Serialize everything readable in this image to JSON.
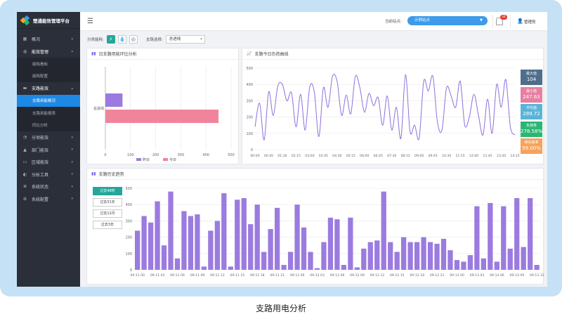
{
  "app": {
    "title": "楚通能效管理平台"
  },
  "sidebar": {
    "items": [
      {
        "label": "概况",
        "icon": "dashboard-icon",
        "sub": false
      },
      {
        "label": "能效管理",
        "icon": "energy-icon",
        "sub": false,
        "open": true
      },
      {
        "label": "能耗看板",
        "sub": true
      },
      {
        "label": "能耗配置",
        "sub": true
      },
      {
        "label": "支路能效",
        "icon": "branch-icon",
        "sub": false,
        "open": true
      },
      {
        "label": "支路用能概况",
        "sub": true,
        "active": true
      },
      {
        "label": "支路用能报表",
        "sub": true
      },
      {
        "label": "同比分析",
        "sub": true
      },
      {
        "label": "分项能效",
        "icon": "category-icon",
        "sub": false
      },
      {
        "label": "部门能效",
        "icon": "department-icon",
        "sub": false
      },
      {
        "label": "区域能效",
        "icon": "region-icon",
        "sub": false
      },
      {
        "label": "分析工具",
        "icon": "tools-icon",
        "sub": false
      },
      {
        "label": "系统状态",
        "icon": "status-icon",
        "sub": false
      },
      {
        "label": "系统配置",
        "icon": "settings-icon",
        "sub": false
      }
    ]
  },
  "topbar": {
    "site_label": "当前站点:",
    "site_value": "示例站点",
    "notification_count": "34",
    "user_name": "管理员"
  },
  "filter": {
    "energy_label": "分类能耗:",
    "branch_label": "支路选择:",
    "branch_value": "总进线"
  },
  "ring_panel": {
    "title": "日支路用能环比分析"
  },
  "load_panel": {
    "title": "支路今日负荷曲线"
  },
  "history_panel": {
    "title": "支路历史趋势"
  },
  "stats": [
    {
      "label": "最大值",
      "value": "104",
      "color": "#4f6e8c"
    },
    {
      "label": "最小值",
      "value": "247.63",
      "color": "#e97ea1"
    },
    {
      "label": "平均值",
      "value": "289.72",
      "color": "#5bb4d8"
    },
    {
      "label": "负荷率",
      "value": "278.58%",
      "color": "#2bb673"
    },
    {
      "label": "峰谷差率",
      "value": "59.00%",
      "color": "#f7a25c"
    }
  ],
  "range_buttons": [
    "过去48时",
    "过去31天",
    "过去12月",
    "过去3年"
  ],
  "caption": "支路用电分析",
  "colors": {
    "accent": "#1e88e5",
    "purple": "#9b7bdf",
    "pink": "#f0849c",
    "teal": "#26a69a"
  },
  "chart_data": [
    {
      "type": "bar",
      "orientation": "horizontal",
      "categories": [
        "总进线"
      ],
      "series": [
        {
          "name": "昨日",
          "values": [
            68
          ]
        },
        {
          "name": "今日",
          "values": [
            450
          ]
        }
      ],
      "xlim": [
        0,
        500
      ],
      "xticks": [
        "0",
        "100",
        "200",
        "300",
        "400",
        "500"
      ],
      "legend": "bottom"
    },
    {
      "type": "line",
      "x": [
        "00:00",
        "00:45",
        "01:30",
        "02:15",
        "03:00",
        "03:45",
        "04:30",
        "05:15",
        "06:00",
        "06:45",
        "07:30",
        "08:15",
        "09:00",
        "09:45",
        "10:30",
        "11:15",
        "12:00",
        "12:45",
        "13:30",
        "14:15"
      ],
      "y": [
        140,
        285,
        60,
        355,
        210,
        390,
        400,
        300,
        350,
        140,
        340,
        120,
        385,
        355,
        80,
        380,
        260,
        450,
        420,
        210,
        335,
        220,
        450,
        380,
        230,
        345,
        270,
        320,
        150,
        330,
        120,
        260,
        70,
        460,
        110,
        150,
        70,
        420,
        360,
        450,
        170,
        120,
        380,
        330,
        260,
        420,
        150,
        200,
        340,
        210,
        90,
        310,
        100,
        400,
        260,
        430,
        140,
        90
      ],
      "ylim": [
        0,
        500
      ],
      "yticks": [
        "0",
        "100",
        "200",
        "300",
        "400",
        "500"
      ],
      "grid": true
    },
    {
      "type": "bar",
      "x_tick_labels": [
        "09-11 00",
        "09-11 03",
        "09-11 06",
        "09-11 09",
        "09-11 12",
        "09-11 15",
        "09-11 18",
        "09-11 21",
        "09-12 00",
        "09-12 03",
        "09-12 06",
        "09-12 09",
        "09-12 12",
        "09-12 15",
        "09-12 18",
        "09-12 21",
        "09-13 00",
        "09-13 03",
        "09-13 06",
        "09-13 09",
        "09-13 12"
      ],
      "values": [
        240,
        330,
        290,
        420,
        150,
        480,
        70,
        360,
        330,
        340,
        20,
        240,
        300,
        470,
        20,
        430,
        440,
        280,
        400,
        110,
        250,
        380,
        30,
        110,
        400,
        260,
        110,
        10,
        170,
        320,
        310,
        30,
        320,
        15,
        130,
        170,
        180,
        480,
        170,
        110,
        200,
        170,
        170,
        200,
        170,
        160,
        190,
        120,
        60,
        50,
        90,
        390,
        70,
        410,
        50,
        390,
        130,
        440,
        140,
        440,
        30
      ],
      "ylim": [
        0,
        500
      ],
      "yticks": [
        "0",
        "100",
        "200",
        "300",
        "400",
        "500"
      ],
      "grid": true
    }
  ]
}
